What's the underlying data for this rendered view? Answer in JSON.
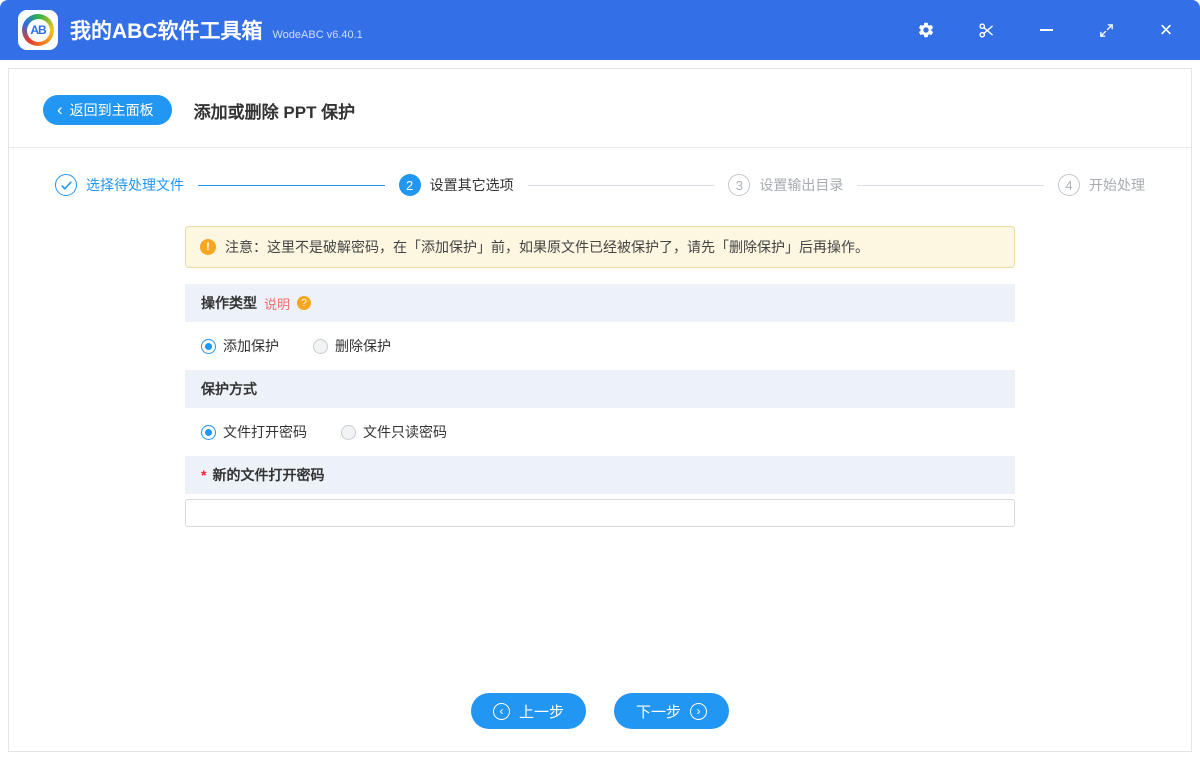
{
  "colors": {
    "titlebar_blue": "#3370e8",
    "accent_blue": "#2196f3",
    "notice_bg": "#fdf6e0",
    "notice_border": "#eed9a1",
    "section_bg": "#edf2f9",
    "warning_orange": "#f7a622",
    "link_red": "#f56c6c",
    "required_red": "#f5222d"
  },
  "titlebar": {
    "logo": "AB",
    "title": "我的ABC软件工具箱",
    "version": "WodeABC v6.40.1",
    "icons": [
      "settings-icon",
      "cut-icon",
      "minimize-icon",
      "resize-icon",
      "close-icon"
    ]
  },
  "toolbar": {
    "back_label": "返回到主面板",
    "back_chevron": "‹",
    "page_title": "添加或删除 PPT 保护"
  },
  "steps": [
    {
      "num": "1",
      "label": "选择待处理文件",
      "state": "done"
    },
    {
      "num": "2",
      "label": "设置其它选项",
      "state": "active"
    },
    {
      "num": "3",
      "label": "设置输出目录",
      "state": "pending"
    },
    {
      "num": "4",
      "label": "开始处理",
      "state": "pending"
    }
  ],
  "notice": {
    "icon_glyph": "!",
    "text": "注意：这里不是破解密码，在「添加保护」前，如果原文件已经被保护了，请先「删除保护」后再操作。"
  },
  "operation_type": {
    "title": "操作类型",
    "help_link": "说明",
    "help_icon_glyph": "?",
    "options": [
      {
        "label": "添加保护",
        "selected": true
      },
      {
        "label": "删除保护",
        "selected": false
      }
    ]
  },
  "protection": {
    "title": "保护方式",
    "options": [
      {
        "label": "文件打开密码",
        "selected": true
      },
      {
        "label": "文件只读密码",
        "selected": false
      }
    ]
  },
  "password": {
    "required_mark": "*",
    "title": "新的文件打开密码",
    "value": ""
  },
  "footer": {
    "prev": "上一步",
    "next": "下一步",
    "prev_icon_glyph": "‹",
    "next_icon_glyph": "›"
  }
}
